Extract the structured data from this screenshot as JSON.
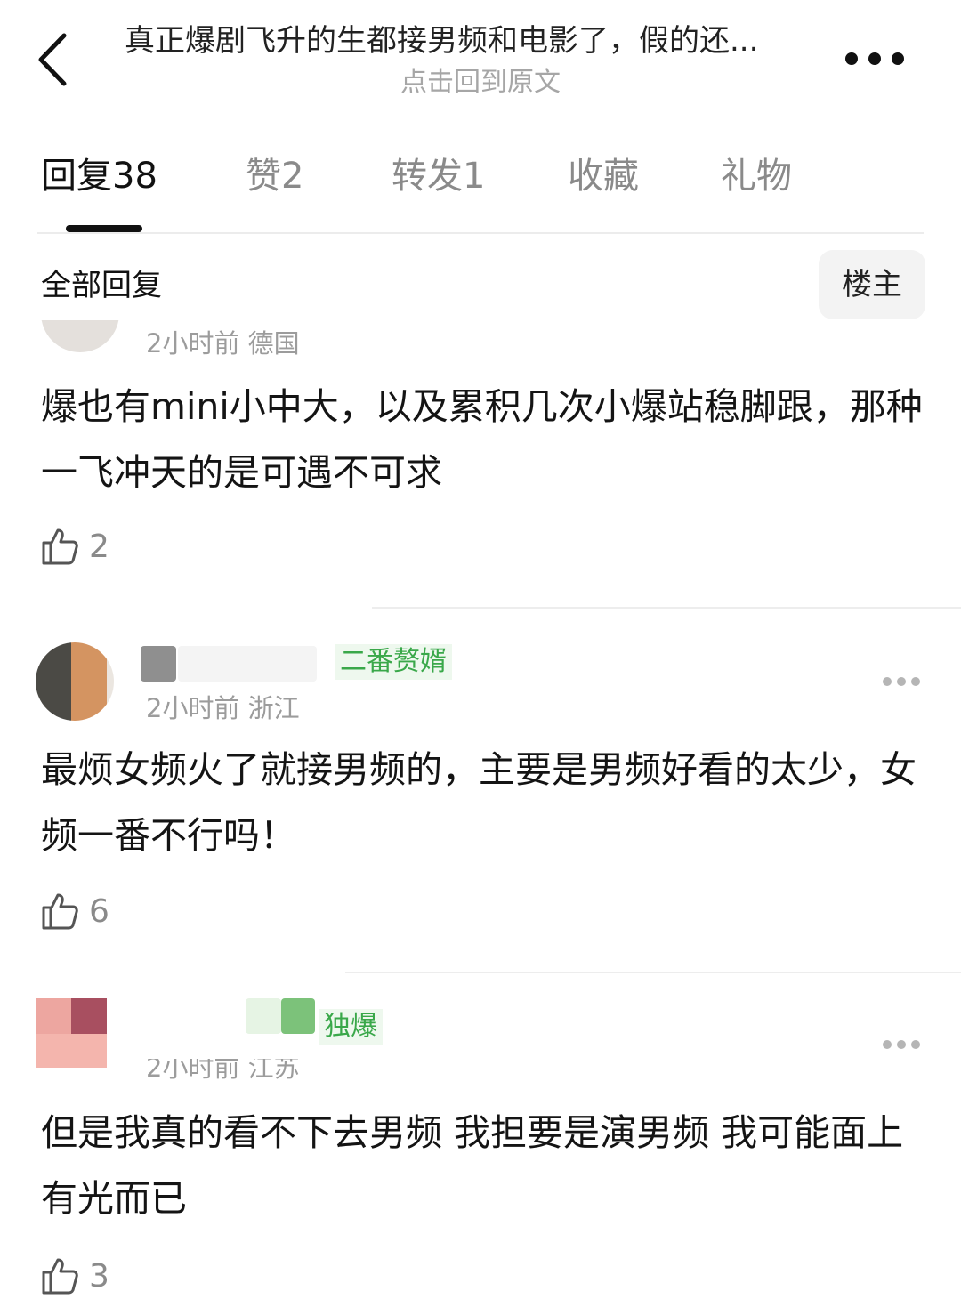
{
  "header": {
    "title": "真正爆剧飞升的生都接男频和电影了，假的还...",
    "subtitle": "点击回到原文"
  },
  "tabs": [
    {
      "label": "回复38",
      "active": true
    },
    {
      "label": "赞2",
      "active": false
    },
    {
      "label": "转发1",
      "active": false
    },
    {
      "label": "收藏",
      "active": false
    },
    {
      "label": "礼物",
      "active": false
    }
  ],
  "section": {
    "title": "全部回复",
    "op_filter_label": "楼主"
  },
  "comments": [
    {
      "meta": "2小时前 德国",
      "content": "爆也有mini小中大，以及累积几次小爆站稳脚跟，那种一飞冲天的是可遇不可求",
      "likes": "2"
    },
    {
      "badge": "二番赘婿",
      "meta": "2小时前 浙江",
      "content": "最烦女频火了就接男频的，主要是男频好看的太少，女频一番不行吗！",
      "likes": "6"
    },
    {
      "badge": "独爆",
      "meta": "2小时前 江苏",
      "content": "但是我真的看不下去男频 我担要是演男频 我可能面上有光而已",
      "likes": "3"
    }
  ]
}
